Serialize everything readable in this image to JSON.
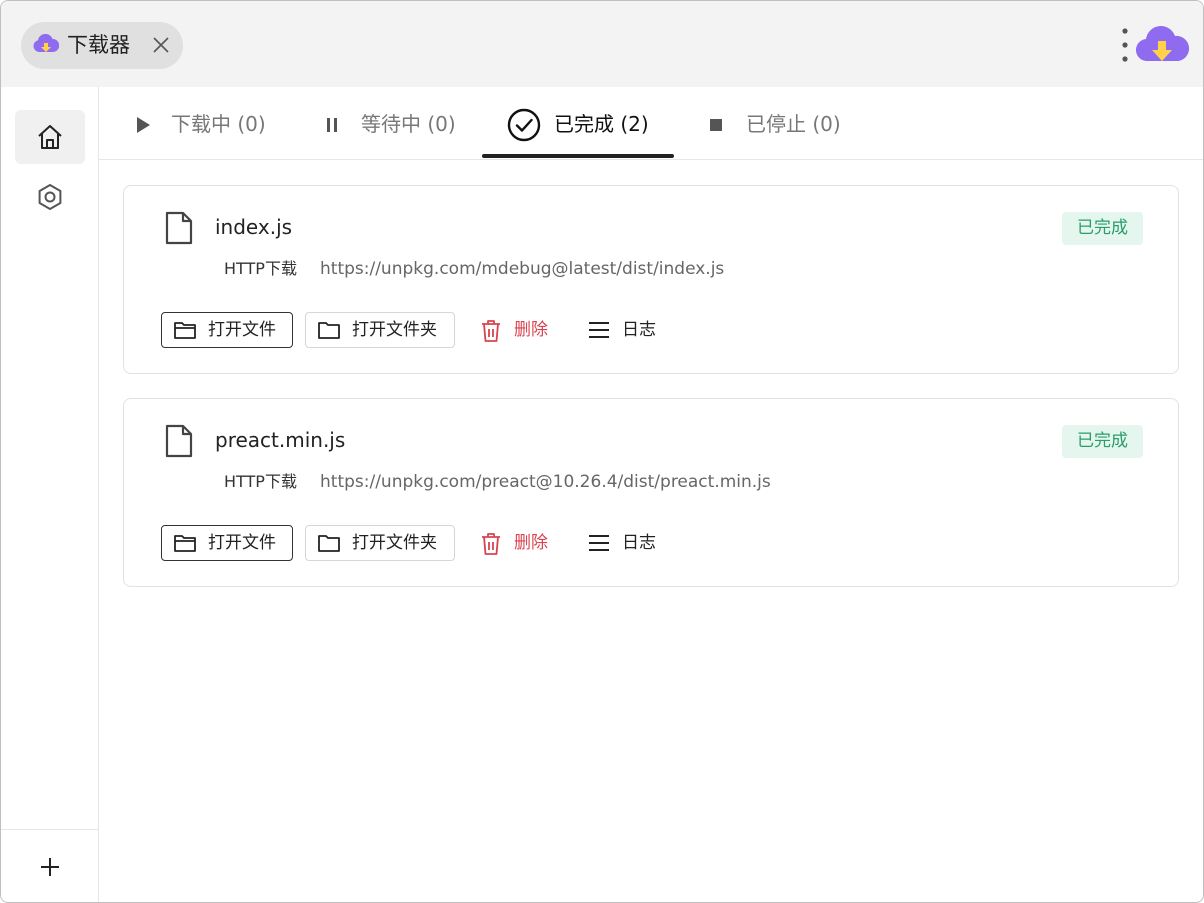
{
  "titlebar": {
    "tab_label": "下载器"
  },
  "tabs": [
    {
      "label": "下载中 (0)",
      "icon": "play-icon"
    },
    {
      "label": "等待中 (0)",
      "icon": "pause-icon"
    },
    {
      "label": "已完成 (2)",
      "icon": "check-circle-icon"
    },
    {
      "label": "已停止 (0)",
      "icon": "stop-icon"
    }
  ],
  "active_tab": 2,
  "colors": {
    "accent": "#8f6bf0",
    "success_bg": "#e4f6ee",
    "success_text": "#2a9d6a",
    "danger": "#d9434f"
  },
  "downloads": [
    {
      "name": "index.js",
      "status": "已完成",
      "protocol": "HTTP下载",
      "url": "https://unpkg.com/mdebug@latest/dist/index.js"
    },
    {
      "name": "preact.min.js",
      "status": "已完成",
      "protocol": "HTTP下载",
      "url": "https://unpkg.com/preact@10.26.4/dist/preact.min.js"
    }
  ],
  "actions": {
    "open_file": "打开文件",
    "open_folder": "打开文件夹",
    "delete": "删除",
    "log": "日志"
  }
}
